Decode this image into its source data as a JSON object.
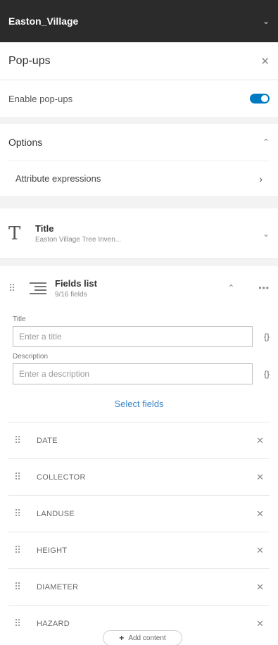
{
  "topbar": {
    "title": "Easton_Village",
    "chevron_icon": "chevron-down-icon"
  },
  "panel": {
    "title": "Pop-ups",
    "close_icon": "close-icon"
  },
  "enable_popups": {
    "label": "Enable pop-ups",
    "enabled": true,
    "accent": "#007ac2"
  },
  "options": {
    "title": "Options",
    "attribute_expressions_label": "Attribute expressions"
  },
  "title_element": {
    "icon_glyph": "T",
    "label": "Title",
    "summary": "Easton Village Tree Inven..."
  },
  "fields_list": {
    "label": "Fields list",
    "summary": "9/16 fields",
    "title_label": "Title",
    "title_placeholder": "Enter a title",
    "description_label": "Description",
    "description_placeholder": "Enter a description",
    "braces": "{}",
    "select_fields_label": "Select fields",
    "fields": [
      {
        "name": "DATE"
      },
      {
        "name": "COLLECTOR"
      },
      {
        "name": "LANDUSE"
      },
      {
        "name": "HEIGHT"
      },
      {
        "name": "DIAMETER"
      },
      {
        "name": "HAZARD"
      }
    ]
  },
  "add_content": {
    "label": "Add content"
  },
  "colors": {
    "topbar": "#2b2b2b",
    "link": "#3a87c8",
    "toggle": "#007ac2"
  }
}
